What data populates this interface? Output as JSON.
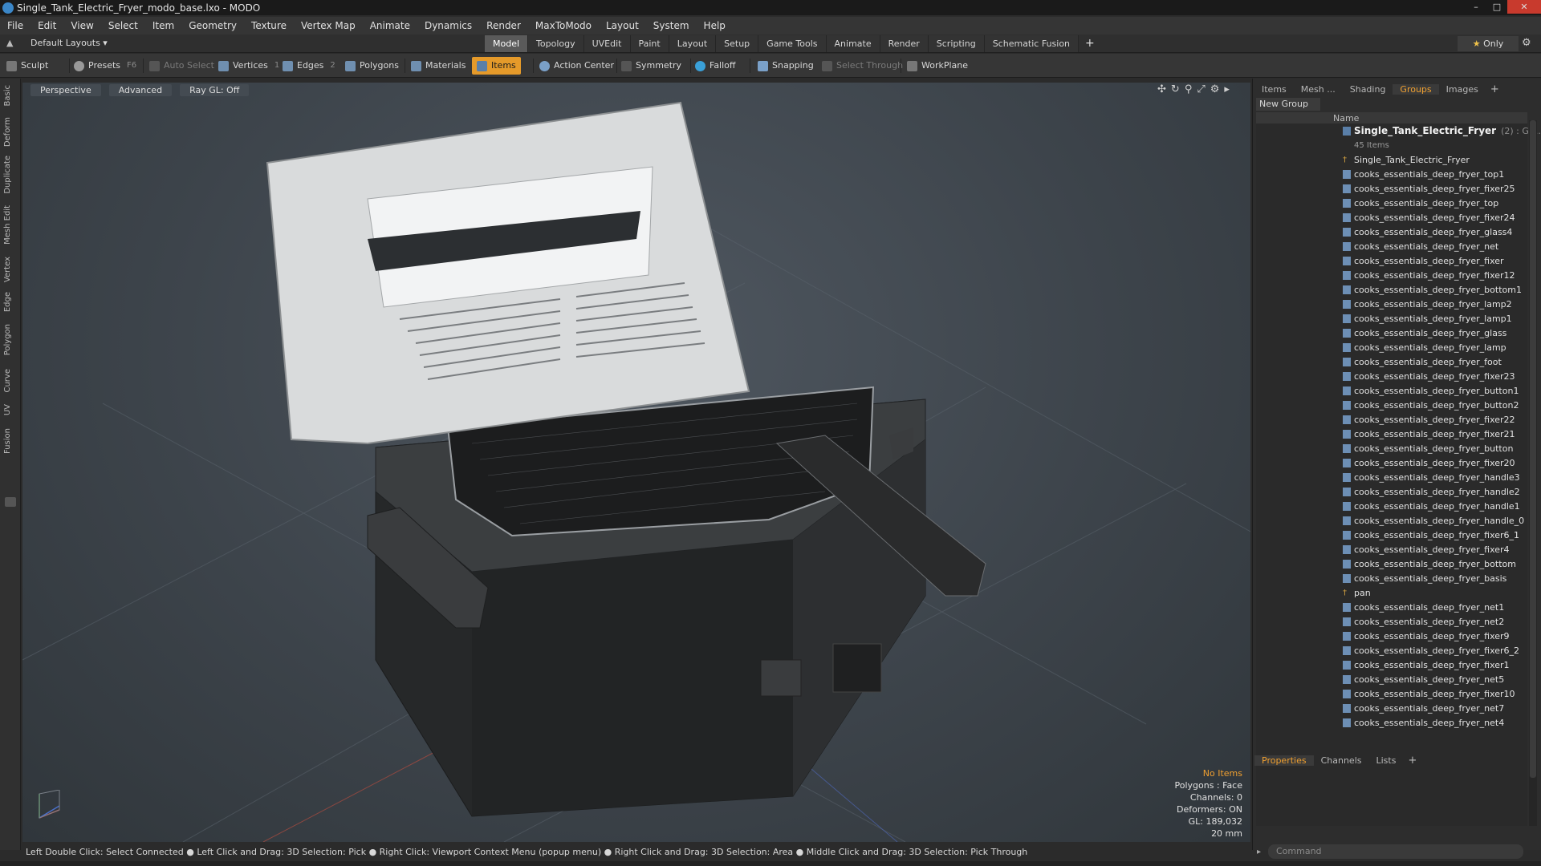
{
  "window": {
    "title": "Single_Tank_Electric_Fryer_modo_base.lxo - MODO",
    "controls": [
      "–",
      "□",
      "✕"
    ]
  },
  "menu": [
    "File",
    "Edit",
    "View",
    "Select",
    "Item",
    "Geometry",
    "Texture",
    "Vertex Map",
    "Animate",
    "Dynamics",
    "Render",
    "MaxToModo",
    "Layout",
    "System",
    "Help"
  ],
  "layout": {
    "name": "Default Layouts ▾",
    "tabs": [
      "Model",
      "Topology",
      "UVEdit",
      "Paint",
      "Layout",
      "Setup",
      "Game Tools",
      "Animate",
      "Render",
      "Scripting",
      "Schematic Fusion"
    ],
    "active_tab": "Model",
    "only_label": "Only"
  },
  "toolbar": {
    "sculpt": "Sculpt",
    "presets": "Presets",
    "presets_key": "F6",
    "auto_select": "Auto Select",
    "vertices": "Vertices",
    "vertices_count": "1",
    "edges": "Edges",
    "edges_count": "2",
    "polygons": "Polygons",
    "materials": "Materials",
    "items": "Items",
    "action_center": "Action Center",
    "symmetry": "Symmetry",
    "falloff": "Falloff",
    "snapping": "Snapping",
    "select_through": "Select Through",
    "workplane": "WorkPlane"
  },
  "left_tabs": [
    "Basic",
    "Deform",
    "Duplicate",
    "Mesh Edit",
    "Vertex",
    "Edge",
    "Polygon",
    "Curve",
    "UV",
    "Fusion"
  ],
  "viewport": {
    "view": "Perspective",
    "shading": "Advanced",
    "raygl": "Ray GL: Off",
    "info": {
      "selection": "No Items",
      "polygons": "Polygons : Face",
      "channels": "Channels: 0",
      "deformers": "Deformers: ON",
      "gl": "GL: 189,032",
      "scale": "20 mm"
    }
  },
  "right_panel": {
    "tabs": [
      "Items",
      "Mesh ...",
      "Shading",
      "Groups",
      "Images"
    ],
    "active_tab": "Groups",
    "new_group": "New Group",
    "column_name": "Name",
    "group_name": "Single_Tank_Electric_Fryer",
    "group_count": "(2) : Gr ...",
    "group_sub": "45 Items",
    "items": [
      "Single_Tank_Electric_Fryer",
      "cooks_essentials_deep_fryer_top1",
      "cooks_essentials_deep_fryer_fixer25",
      "cooks_essentials_deep_fryer_top",
      "cooks_essentials_deep_fryer_fixer24",
      "cooks_essentials_deep_fryer_glass4",
      "cooks_essentials_deep_fryer_net",
      "cooks_essentials_deep_fryer_fixer",
      "cooks_essentials_deep_fryer_fixer12",
      "cooks_essentials_deep_fryer_bottom1",
      "cooks_essentials_deep_fryer_lamp2",
      "cooks_essentials_deep_fryer_lamp1",
      "cooks_essentials_deep_fryer_glass",
      "cooks_essentials_deep_fryer_lamp",
      "cooks_essentials_deep_fryer_foot",
      "cooks_essentials_deep_fryer_fixer23",
      "cooks_essentials_deep_fryer_button1",
      "cooks_essentials_deep_fryer_button2",
      "cooks_essentials_deep_fryer_fixer22",
      "cooks_essentials_deep_fryer_fixer21",
      "cooks_essentials_deep_fryer_button",
      "cooks_essentials_deep_fryer_fixer20",
      "cooks_essentials_deep_fryer_handle3",
      "cooks_essentials_deep_fryer_handle2",
      "cooks_essentials_deep_fryer_handle1",
      "cooks_essentials_deep_fryer_handle_0",
      "cooks_essentials_deep_fryer_fixer6_1",
      "cooks_essentials_deep_fryer_fixer4",
      "cooks_essentials_deep_fryer_bottom",
      "cooks_essentials_deep_fryer_basis",
      "pan",
      "cooks_essentials_deep_fryer_net1",
      "cooks_essentials_deep_fryer_net2",
      "cooks_essentials_deep_fryer_fixer9",
      "cooks_essentials_deep_fryer_fixer6_2",
      "cooks_essentials_deep_fryer_fixer1",
      "cooks_essentials_deep_fryer_net5",
      "cooks_essentials_deep_fryer_fixer10",
      "cooks_essentials_deep_fryer_net7",
      "cooks_essentials_deep_fryer_net4"
    ],
    "locator_items": [
      "Single_Tank_Electric_Fryer",
      "pan"
    ],
    "props_tabs": [
      "Properties",
      "Channels",
      "Lists"
    ],
    "props_active": "Properties",
    "command_placeholder": "Command"
  },
  "status_bar": "Left Double Click: Select Connected ● Left Click and Drag: 3D Selection: Pick ● Right Click: Viewport Context Menu (popup menu) ● Right Click and Drag: 3D Selection: Area ● Middle Click and Drag: 3D Selection: Pick Through",
  "colors": {
    "accent": "#f0a030",
    "items_button": "#e59a2a",
    "close_button": "#c83a2d"
  }
}
